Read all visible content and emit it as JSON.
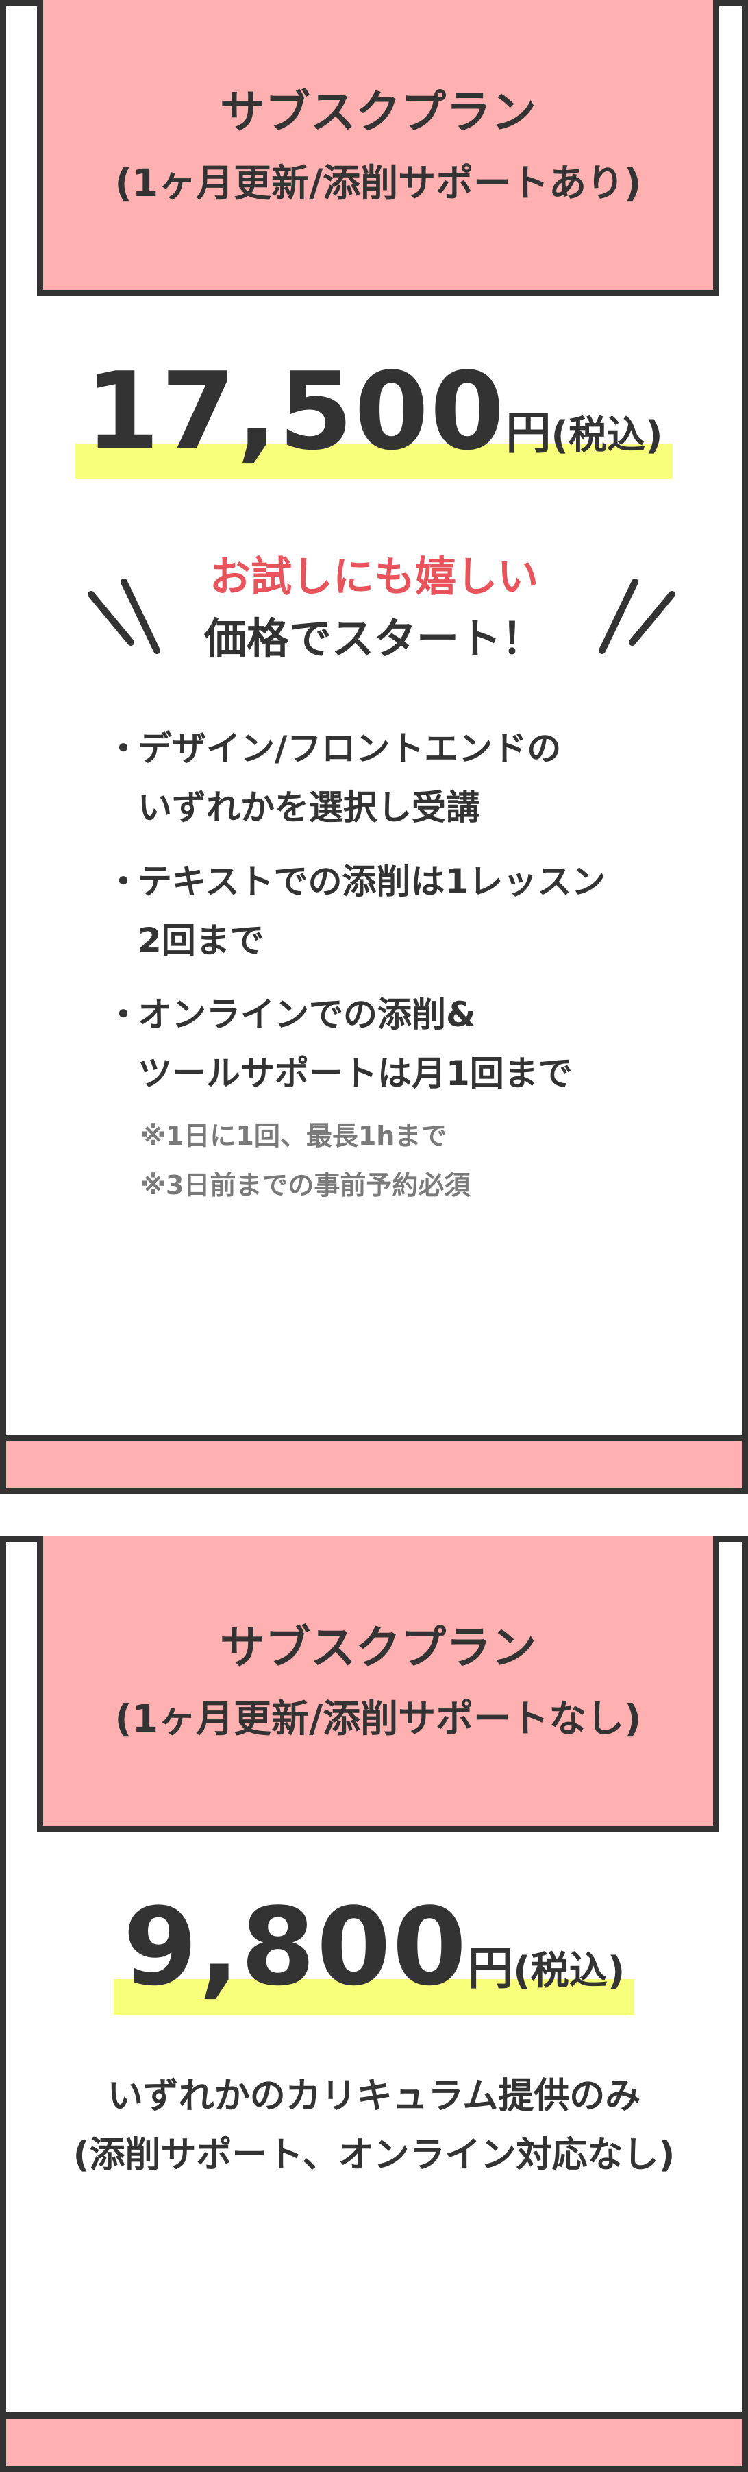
{
  "plans": [
    {
      "title": "サブスクプラン",
      "subtitle": "(1ヶ月更新/添削サポートあり)",
      "price": "17,500",
      "price_unit": "円",
      "price_tax": "(税込)",
      "catch_line1": "お試しにも嬉しい",
      "catch_line2": "価格でスタート！",
      "bullet_symbol": "・",
      "features": [
        {
          "line1": "デザイン/フロントエンドの",
          "line2": "いずれかを選択し受講"
        },
        {
          "line1": "テキストでの添削は1レッスン",
          "line2": "2回まで"
        },
        {
          "line1": "オンラインでの添削&",
          "line2": "ツールサポートは月1回まで"
        }
      ],
      "notes": [
        "※1日に1回、最長1hまで",
        "※3日前までの事前予約必須"
      ]
    },
    {
      "title": "サブスクプラン",
      "subtitle": "(1ヶ月更新/添削サポートなし)",
      "price": "9,800",
      "price_unit": "円",
      "price_tax": "(税込)",
      "description_line1": "いずれかのカリキュラム提供のみ",
      "description_line2": "(添削サポート、オンライン対応なし)"
    }
  ],
  "colors": {
    "header_bg": "#ffb0b0",
    "border": "#333333",
    "highlight": "#f8ff7a",
    "accent_red": "#e8545c",
    "note_gray": "#7a7a7a"
  }
}
